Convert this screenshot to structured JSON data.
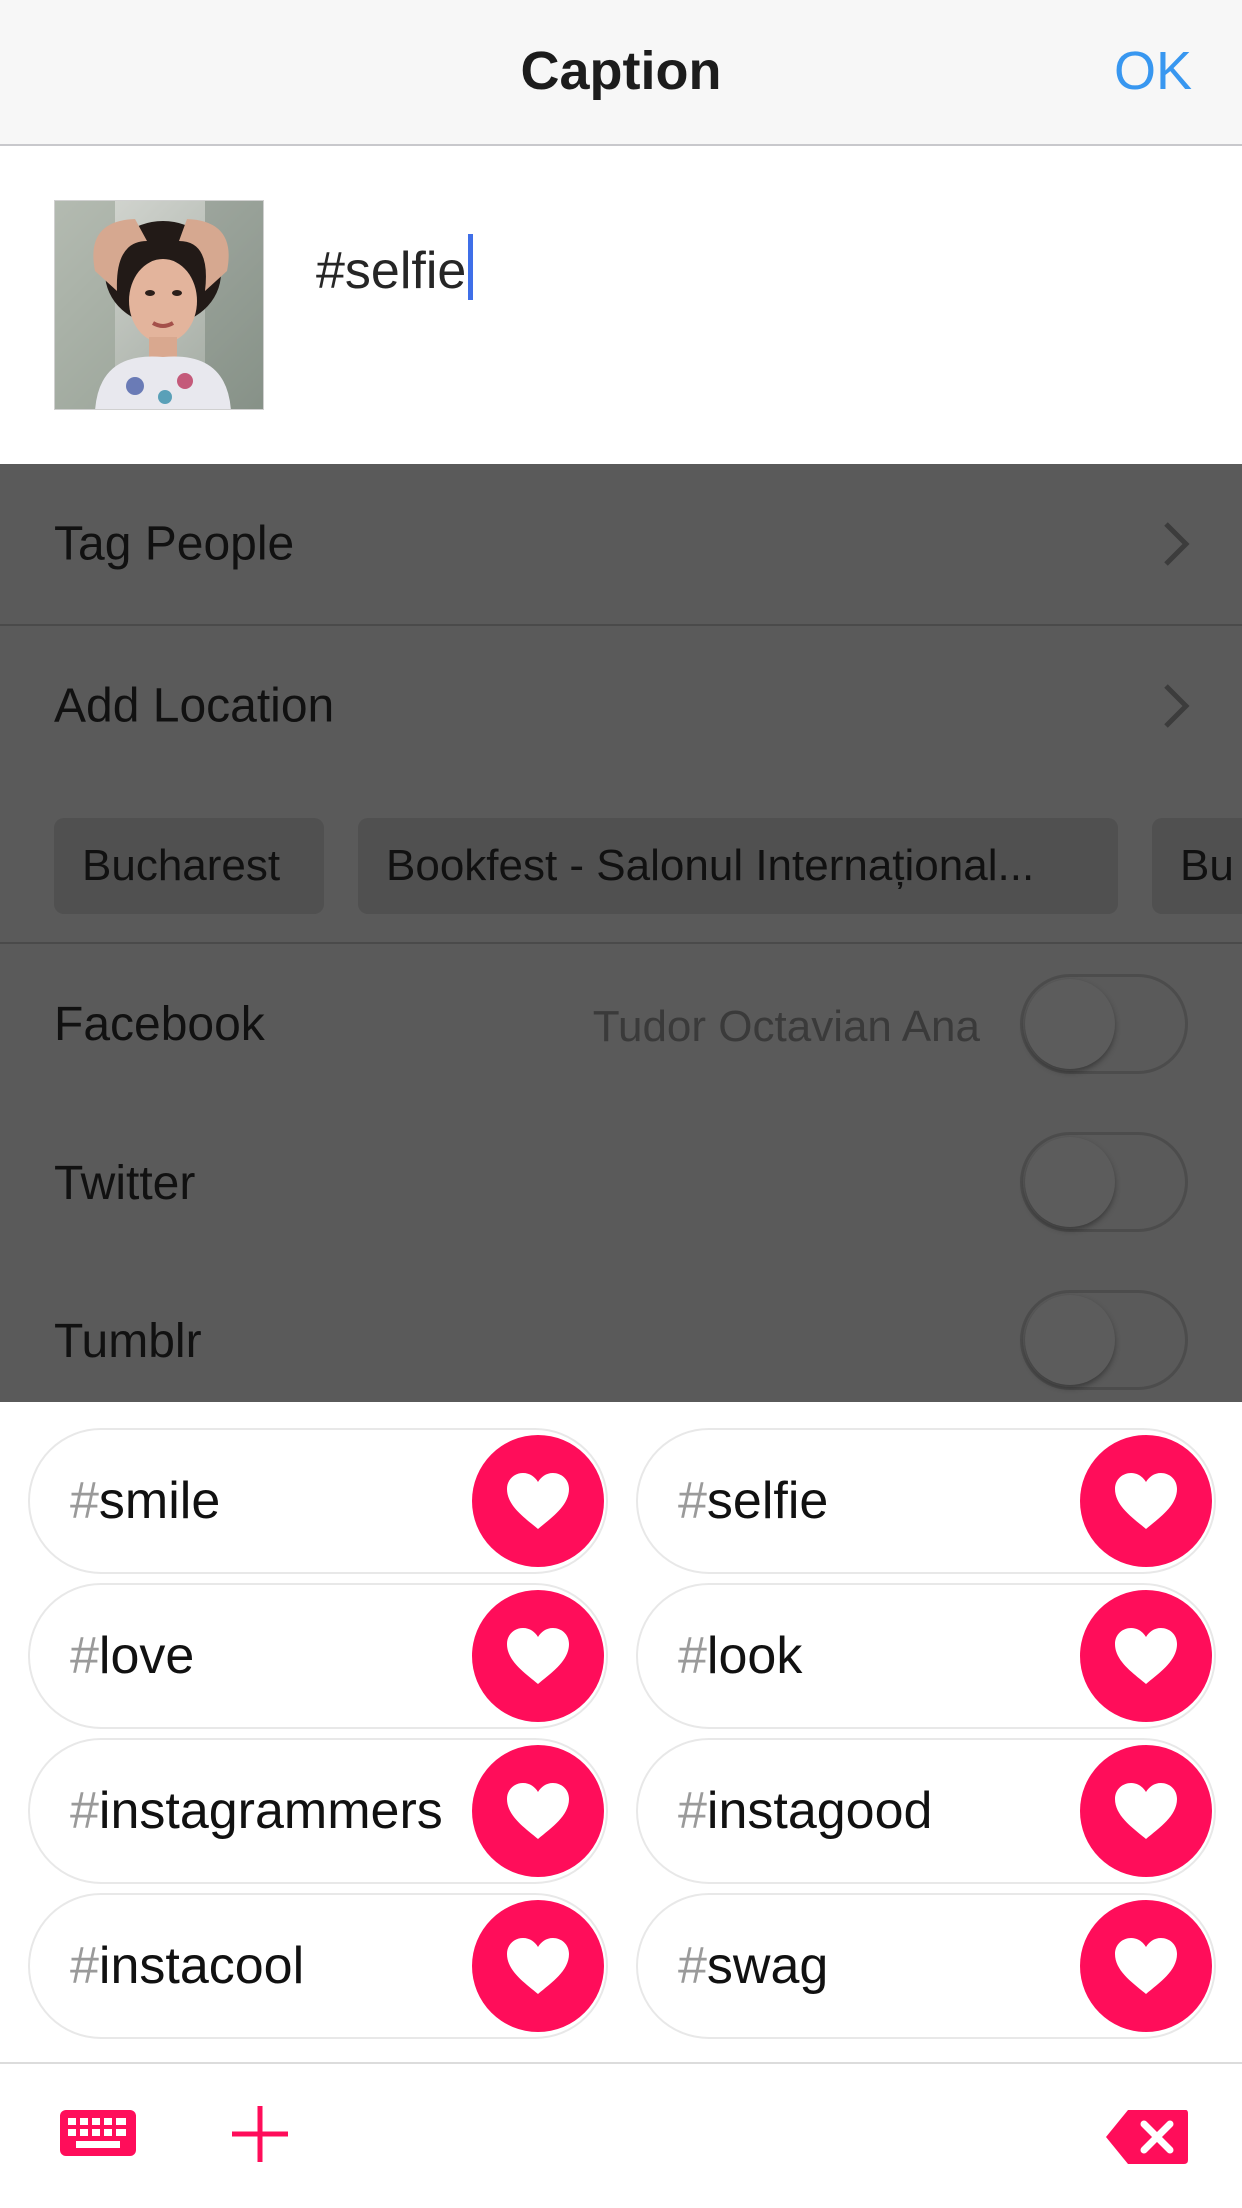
{
  "header": {
    "title": "Caption",
    "ok_label": "OK"
  },
  "compose": {
    "caption_text": "#selfie"
  },
  "options": {
    "tag_people": "Tag People",
    "add_location": "Add Location",
    "location_suggestions": [
      "Bucharest",
      "Bookfest - Salonul Internațional...",
      "Bu"
    ]
  },
  "share": {
    "facebook": {
      "label": "Facebook",
      "account": "Tudor Octavian Ana"
    },
    "twitter": {
      "label": "Twitter"
    },
    "tumblr": {
      "label": "Tumblr"
    }
  },
  "hashtags": [
    {
      "hash": "#",
      "tag": "smile"
    },
    {
      "hash": "#",
      "tag": "selfie"
    },
    {
      "hash": "#",
      "tag": "love"
    },
    {
      "hash": "#",
      "tag": "look"
    },
    {
      "hash": "#",
      "tag": "instagrammers"
    },
    {
      "hash": "#",
      "tag": "instagood"
    },
    {
      "hash": "#",
      "tag": "instacool"
    },
    {
      "hash": "#",
      "tag": "swag"
    }
  ],
  "icons": {
    "keyboard": "keyboard-icon",
    "add": "plus-icon",
    "delete": "backspace-icon",
    "heart": "heart-icon",
    "chevron": "chevron-right-icon"
  },
  "colors": {
    "accent_blue": "#3897f0",
    "heart_pink": "#ff0d5a",
    "cursor_blue": "#3f6fe8",
    "overlay_gray": "#5a5a5a"
  }
}
